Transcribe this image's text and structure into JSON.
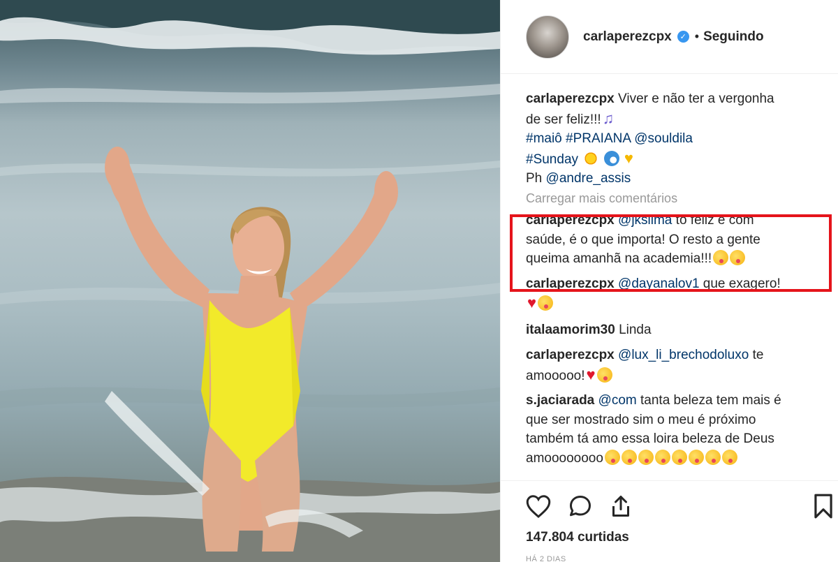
{
  "post": {
    "username": "carlaperezcpx",
    "follow_status": "Seguindo",
    "separator": "•"
  },
  "caption": {
    "user": "carlaperezcpx",
    "line1": "Viver e não ter a vergonha",
    "line2": "de ser feliz!!!",
    "hashtag1": "#maiô",
    "hashtag2": "#PRAIANA",
    "mention1": "@souldila",
    "hashtag3": "#Sunday",
    "ph_label": "Ph",
    "mention2": "@andre_assis"
  },
  "load_more": "Carregar mais comentários",
  "comments": [
    {
      "user": "carlaperezcpx",
      "mention": "@jkslima",
      "line1": "tô feliz e com",
      "line2": "saúde, é o que importa! O resto a gente",
      "line3": "queima amanhã na academia!!!"
    },
    {
      "user": "carlaperezcpx",
      "mention": "@dayanalov1",
      "text": "que exagero!"
    },
    {
      "user": "italaamorim30",
      "text": "Linda"
    },
    {
      "user": "carlaperezcpx",
      "mention": "@lux_li_brechodoluxo",
      "line1": "te",
      "line2": "amooooo!"
    },
    {
      "user": "s.jaciarada",
      "mention": "@com",
      "line1": "tanta beleza tem mais é",
      "line2": "que ser mostrado sim o meu é próximo",
      "line3": "também tá amo essa loira beleza de Deus",
      "line4": "amoooooooo"
    }
  ],
  "stats": {
    "likes": "147.804 curtidas",
    "time": "HÁ 2 DIAS"
  },
  "icons": [
    "heart-icon",
    "comment-icon",
    "share-icon",
    "bookmark-icon",
    "verified-icon"
  ],
  "colors": {
    "accent_blue": "#3897f0",
    "mention_blue": "#003569",
    "highlight_red": "#e5141b",
    "muted_gray": "#999999"
  }
}
